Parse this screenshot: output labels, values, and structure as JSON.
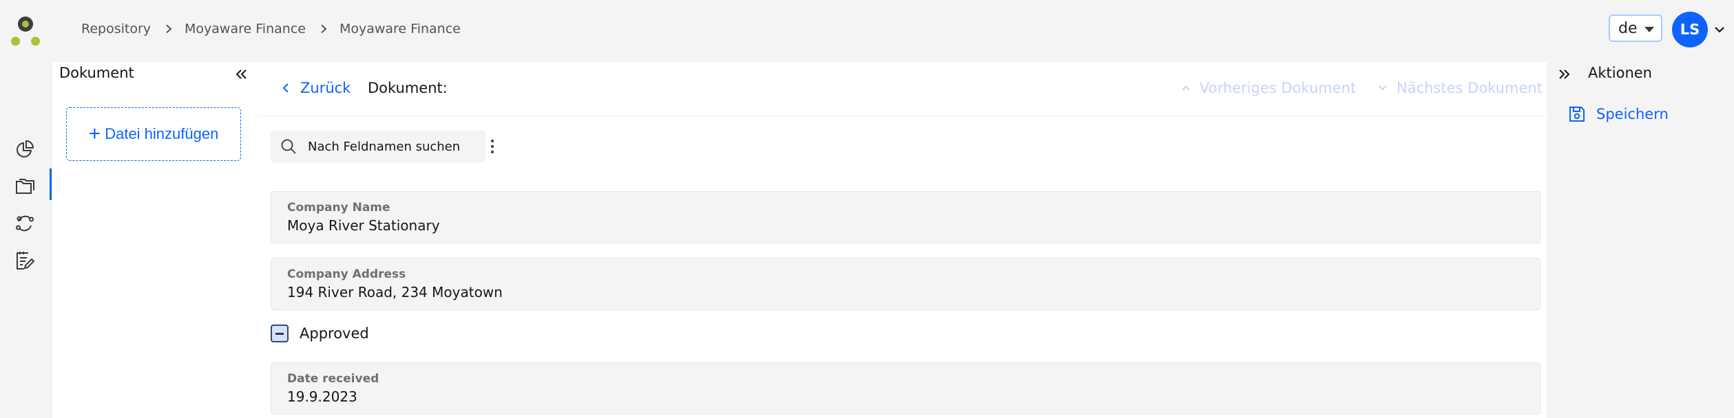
{
  "header": {
    "breadcrumbs": [
      "Repository",
      "Moyaware Finance",
      "Moyaware Finance"
    ],
    "language": "de",
    "user_initials": "LS"
  },
  "rail": {
    "icons": [
      "dashboard-icon",
      "folder-icon",
      "sync-icon",
      "document-edit-icon"
    ],
    "active": "folder-icon"
  },
  "document_panel": {
    "title": "Dokument",
    "add_file_label": "Datei hinzufügen"
  },
  "main": {
    "back_label": "Zurück",
    "document_label": "Dokument:",
    "prev_label": "Vorheriges Dokument",
    "next_label": "Nächstes Dokument",
    "search_placeholder": "Nach Feldnamen suchen",
    "fields": [
      {
        "label": "Company Name",
        "value": "Moya River Stationary"
      },
      {
        "label": "Company Address",
        "value": "194 River Road, 234 Moyatown"
      },
      {
        "label": "Date received",
        "value": "19.9.2023"
      }
    ],
    "checkbox": {
      "label": "Approved",
      "state": "indeterminate"
    }
  },
  "actions_panel": {
    "title": "Aktionen",
    "save_label": "Speichern"
  },
  "colors": {
    "accent": "#0f62fe",
    "logo_dark": "#3d3d3d",
    "logo_green": "#a8c43a"
  }
}
